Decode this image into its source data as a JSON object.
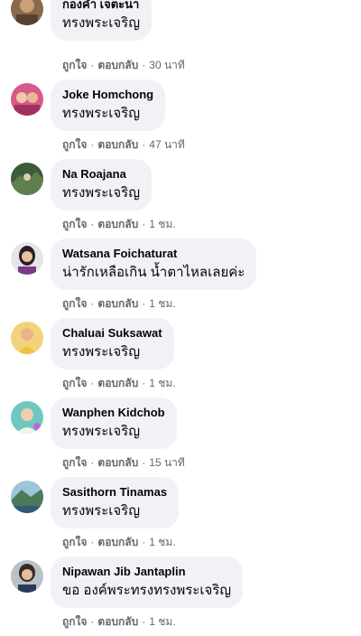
{
  "actions": {
    "like": "ถูกใจ",
    "reply": "ตอบกลับ",
    "separator": "·"
  },
  "comments": [
    {
      "author": "กองคำ เจตะนา",
      "text": "ทรงพระเจริญ",
      "time": "30 นาที",
      "avatar_icon": "user-avatar-icon"
    },
    {
      "author": "Joke Homchong",
      "text": "ทรงพระเจริญ",
      "time": "47 นาที",
      "avatar_icon": "user-avatar-icon"
    },
    {
      "author": "Na Roajana",
      "text": "ทรงพระเจริญ",
      "time": "1 ชม.",
      "avatar_icon": "user-avatar-icon"
    },
    {
      "author": "Watsana Foichaturat",
      "text": "น่ารักเหลือเกิน น้ำตาไหลเลยค่ะ",
      "time": "1 ชม.",
      "avatar_icon": "user-avatar-icon"
    },
    {
      "author": "Chaluai Suksawat",
      "text": "ทรงพระเจริญ",
      "time": "1 ชม.",
      "avatar_icon": "user-avatar-icon"
    },
    {
      "author": "Wanphen Kidchob",
      "text": "ทรงพระเจริญ",
      "time": "15 นาที",
      "avatar_icon": "user-avatar-icon"
    },
    {
      "author": "Sasithorn Tinamas",
      "text": "ทรงพระเจริญ",
      "time": "1 ชม.",
      "avatar_icon": "user-avatar-icon"
    },
    {
      "author": "Nipawan Jib Jantaplin",
      "text": "ขอ องค์พระทรงทรงพระเจริญ",
      "time": "1 ชม.",
      "avatar_icon": "user-avatar-icon"
    }
  ],
  "colors": {
    "bubble": "#f0f2f5",
    "text": "#050505",
    "meta": "#65676b"
  }
}
